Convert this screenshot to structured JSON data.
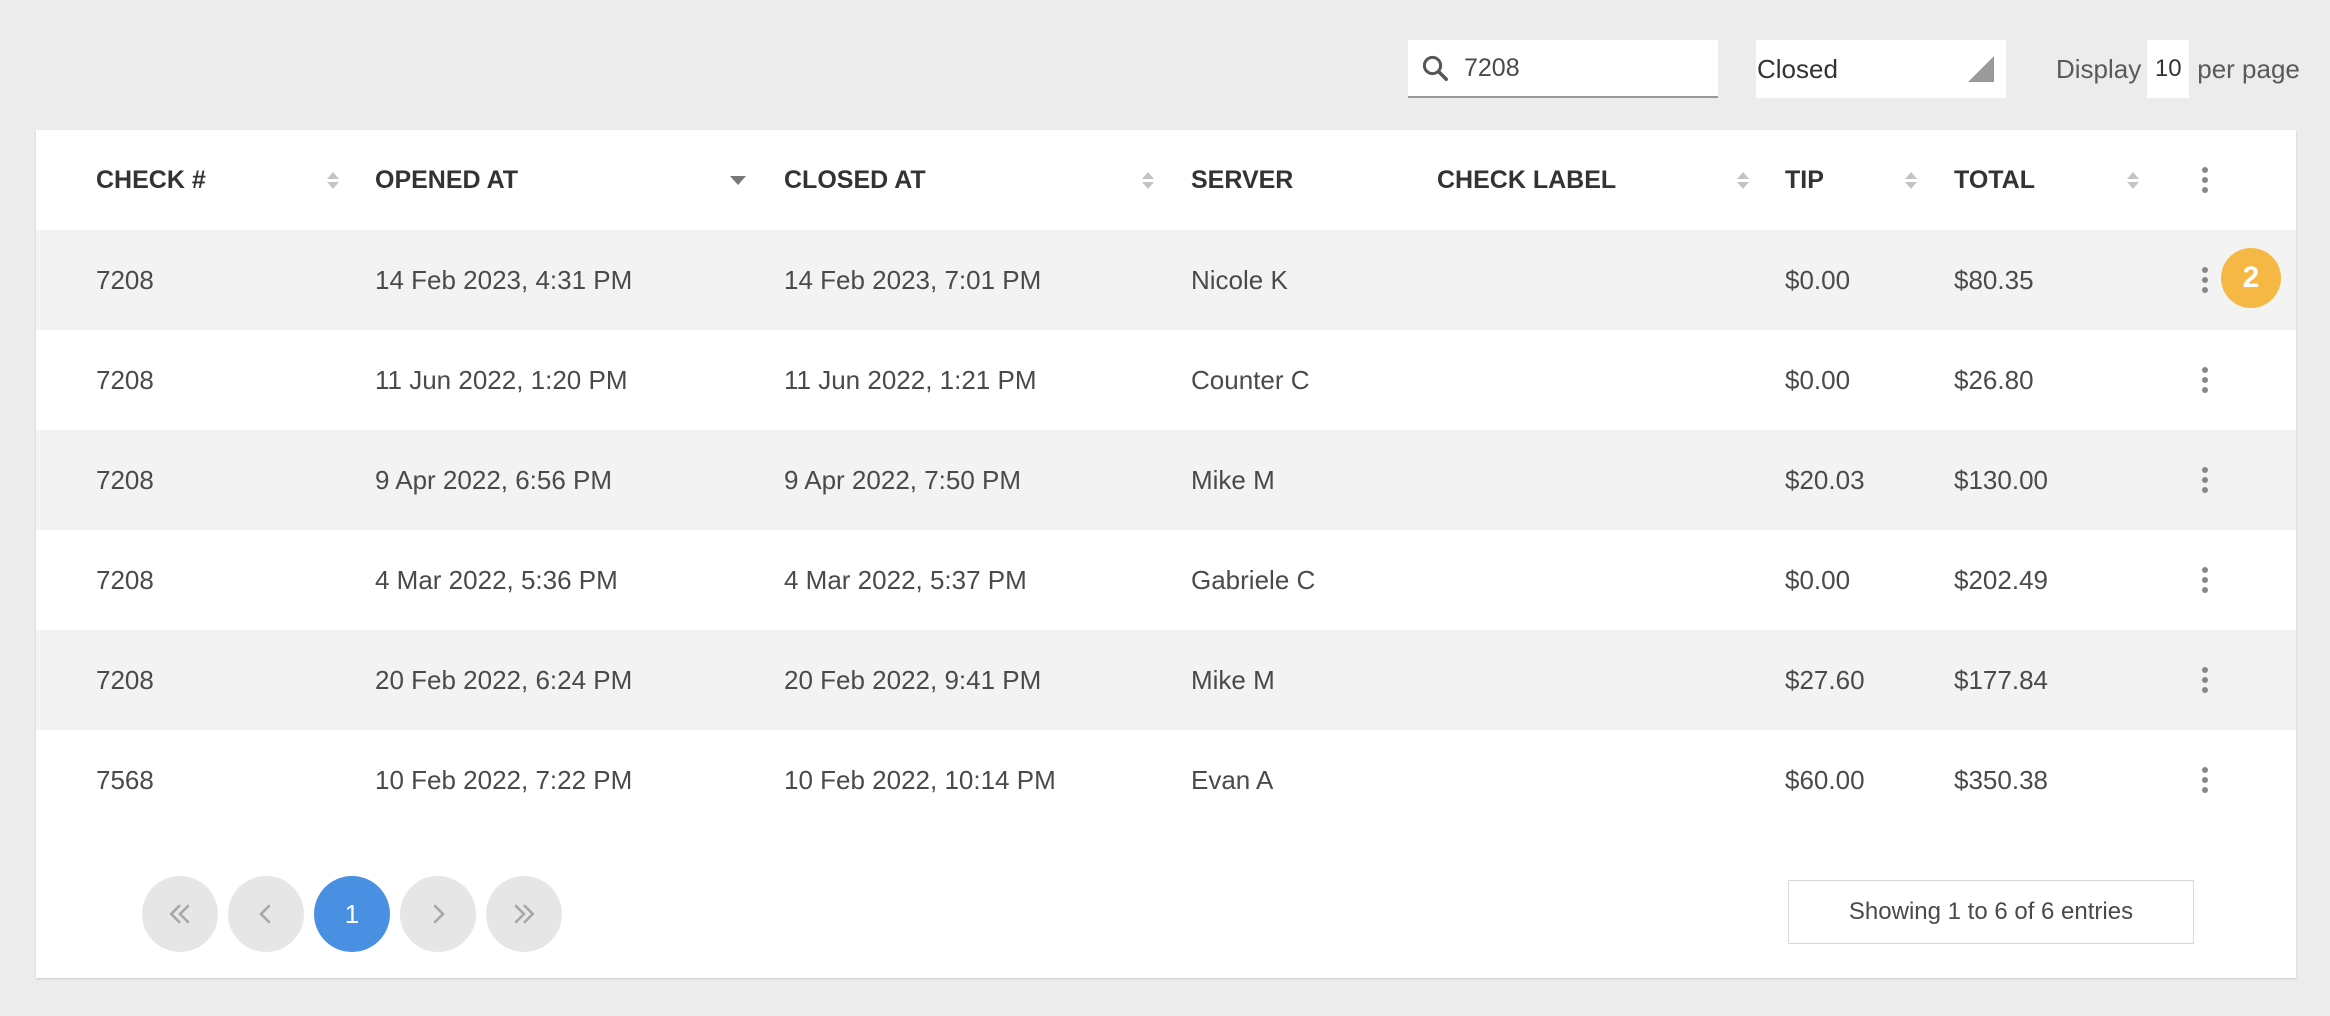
{
  "toolbar": {
    "search_value": "7208",
    "status_selected": "Closed",
    "display_label": "Display",
    "per_page_value": "10",
    "per_page_label": "per page"
  },
  "table": {
    "columns": [
      "CHECK #",
      "OPENED AT",
      "CLOSED AT",
      "SERVER",
      "CHECK LABEL",
      "TIP",
      "TOTAL"
    ],
    "rows": [
      {
        "check": "7208",
        "opened": "14 Feb 2023, 4:31 PM",
        "closed": "14 Feb 2023, 7:01 PM",
        "server": "Nicole K",
        "label": "",
        "tip": "$0.00",
        "total": "$80.35"
      },
      {
        "check": "7208",
        "opened": "11 Jun 2022, 1:20 PM",
        "closed": "11 Jun 2022, 1:21 PM",
        "server": "Counter C",
        "label": "",
        "tip": "$0.00",
        "total": "$26.80"
      },
      {
        "check": "7208",
        "opened": "9 Apr 2022, 6:56 PM",
        "closed": "9 Apr 2022, 7:50 PM",
        "server": "Mike M",
        "label": "",
        "tip": "$20.03",
        "total": "$130.00"
      },
      {
        "check": "7208",
        "opened": "4 Mar 2022, 5:36 PM",
        "closed": "4 Mar 2022, 5:37 PM",
        "server": "Gabriele C",
        "label": "",
        "tip": "$0.00",
        "total": "$202.49"
      },
      {
        "check": "7208",
        "opened": "20 Feb 2022, 6:24 PM",
        "closed": "20 Feb 2022, 9:41 PM",
        "server": "Mike M",
        "label": "",
        "tip": "$27.60",
        "total": "$177.84"
      },
      {
        "check": "7568",
        "opened": "10 Feb 2022, 7:22 PM",
        "closed": "10 Feb 2022, 10:14 PM",
        "server": "Evan A",
        "label": "",
        "tip": "$60.00",
        "total": "$350.38"
      }
    ]
  },
  "badge": "2",
  "pagination": {
    "current_page": "1",
    "summary": "Showing 1 to 6 of 6 entries"
  },
  "colors": {
    "accent": "#4a90e2",
    "badge": "#f6b844",
    "background": "#ececec"
  }
}
